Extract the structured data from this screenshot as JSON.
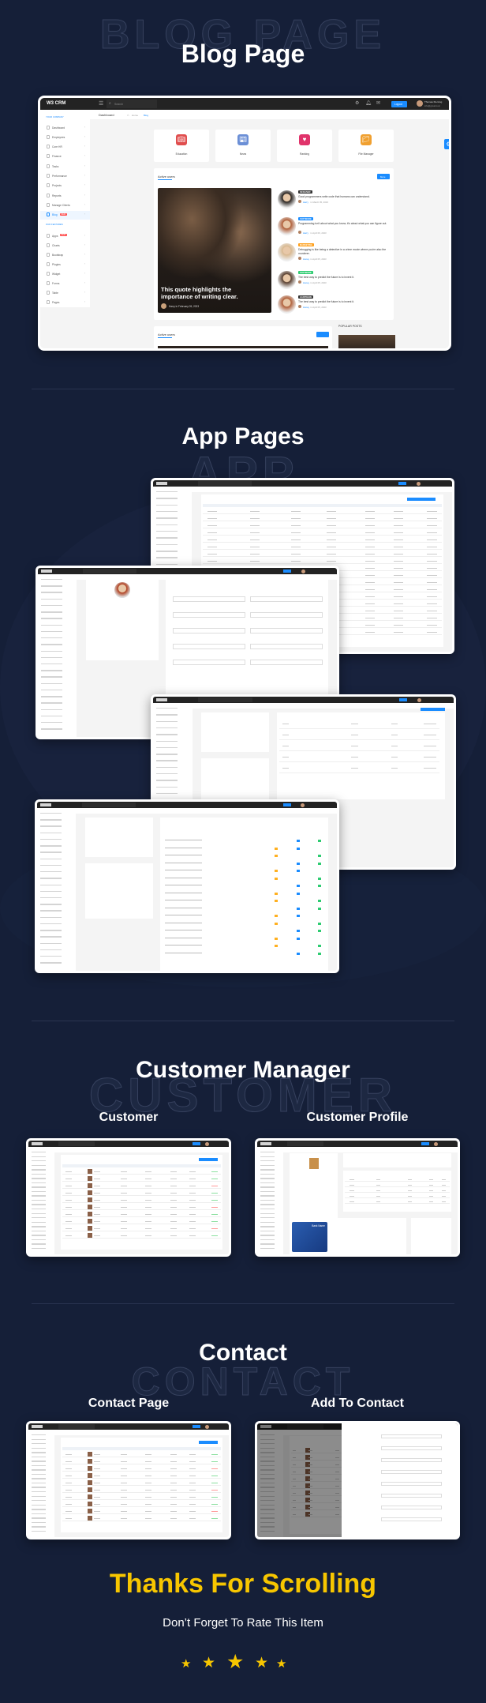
{
  "colors": {
    "background": "#151f38",
    "accent": "#1a8cff",
    "new_badge": "#ff4d4d",
    "thanks": "#f7c600"
  },
  "blog_section": {
    "outline_word": "BLOG PAGE",
    "title": "Blog Page",
    "app": {
      "logo": "W3 CRM",
      "search_placeholder": "Search",
      "logout_label": "Logout",
      "user_name": "Thomas Fleming",
      "user_email": "info@gmail.com",
      "breadcrumb": {
        "page": "Dashboard",
        "home": "Home",
        "current": "Blog"
      },
      "sidebar": {
        "company_heading": "YOUR COMPANY",
        "company_items": [
          {
            "label": "Dashboard"
          },
          {
            "label": "Employees"
          },
          {
            "label": "Core HR"
          },
          {
            "label": "Finance"
          },
          {
            "label": "Tasks"
          },
          {
            "label": "Performance"
          },
          {
            "label": "Projects"
          },
          {
            "label": "Reports"
          },
          {
            "label": "Manage Clients"
          },
          {
            "label": "Blog",
            "badge": "NEW",
            "active": true
          }
        ],
        "features_heading": "OUR FEATURES",
        "feature_items": [
          {
            "label": "Apps",
            "badge": "NEW"
          },
          {
            "label": "Charts"
          },
          {
            "label": "Bootstrap"
          },
          {
            "label": "Plugins"
          },
          {
            "label": "Widget"
          },
          {
            "label": "Forms"
          },
          {
            "label": "Table"
          },
          {
            "label": "Pages"
          }
        ]
      },
      "categories": [
        {
          "label": "Education",
          "icon": "book-icon"
        },
        {
          "label": "News",
          "icon": "newspaper-icon"
        },
        {
          "label": "Ranking",
          "icon": "heart-icon"
        },
        {
          "label": "File Manager",
          "icon": "folder-icon"
        }
      ],
      "active_users": {
        "title": "Active users",
        "more_label": "More",
        "featured": {
          "quote": "This quote highlights the importance of writing clear.",
          "author": "Harry in February 05, 2023"
        },
        "posts": [
          {
            "tag": "DESIGNER",
            "tag_color": "#333333",
            "text": "Good programmers write code that humans can understand.",
            "author": "Harry",
            "date": "in March 05, 2023"
          },
          {
            "tag": "SOFTWARE",
            "tag_color": "#1a8cff",
            "text": "Programming isn't about what you know; it's about what you can figure out.",
            "author": "Harry",
            "date": "in April 06, 2023"
          },
          {
            "tag": "MARKETING",
            "tag_color": "#ff9f1a",
            "text": "Debugging is like being a detective in a crime movie where you're also the murderer.",
            "author": "Honey",
            "date": "in April 05, 2023"
          },
          {
            "tag": "SOFTWARE",
            "tag_color": "#2ecc71",
            "text": "The best way to predict the future is to invent it.",
            "author": "Honey",
            "date": "in April 05, 2023"
          },
          {
            "tag": "HARDWARE",
            "tag_color": "#333333",
            "text": "The best way to predict the future is to invent it.",
            "author": "Honey",
            "date": "in April 05, 2023"
          }
        ]
      },
      "second_card_title": "Active users",
      "popular_posts": "POPULAR POSTS"
    }
  },
  "app_section": {
    "outline_word": "APP",
    "title": "App Pages"
  },
  "customer_section": {
    "outline_word": "CUSTOMER",
    "title": "Customer Manager",
    "left_label": "Customer",
    "right_label": "Customer Profile",
    "card_bank": "Bank Name"
  },
  "contact_section": {
    "outline_word": "CONTACT",
    "title": "Contact",
    "left_label": "Contact Page",
    "right_label": "Add To Contact"
  },
  "footer": {
    "title": "Thanks For Scrolling",
    "subtitle": "Don’t Forget To Rate This Item",
    "rating": 5,
    "rating_max": 5
  }
}
